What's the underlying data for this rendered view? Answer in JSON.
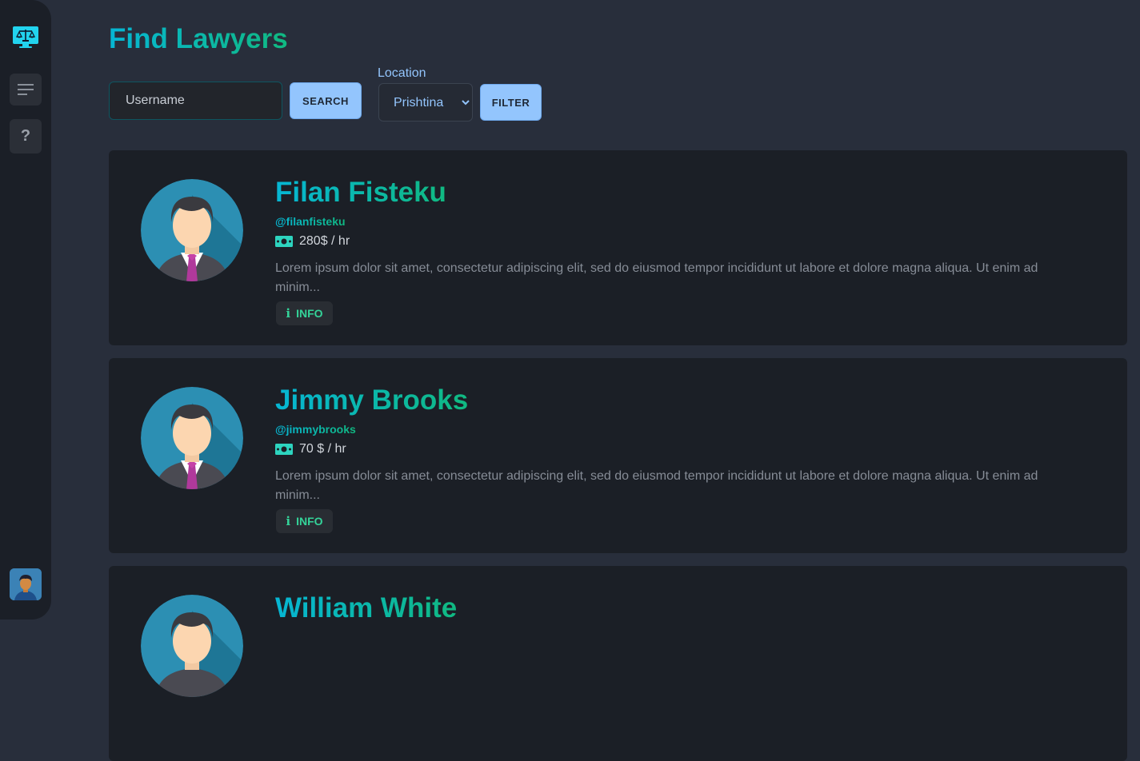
{
  "sidebar": {
    "logo_icon": "lawyer-scale-monitor-icon",
    "menu_icon": "menu-lines-icon",
    "help_label": "?",
    "avatar_icon": "user-avatar-icon"
  },
  "page": {
    "title": "Find Lawyers"
  },
  "search": {
    "placeholder": "Username",
    "button_label": "SEARCH"
  },
  "filter": {
    "location_label": "Location",
    "location_selected": "Prishtina",
    "button_label": "FILTER"
  },
  "lawyers": [
    {
      "name": "Filan Fisteku",
      "username": "@filanfisteku",
      "rate": "280$ / hr",
      "description": "Lorem ipsum dolor sit amet, consectetur adipiscing elit, sed do eiusmod tempor incididunt ut labore et dolore magna aliqua. Ut enim ad minim...",
      "info_label": "INFO"
    },
    {
      "name": "Jimmy Brooks",
      "username": "@jimmybrooks",
      "rate": "70 $ / hr",
      "description": "Lorem ipsum dolor sit amet, consectetur adipiscing elit, sed do eiusmod tempor incididunt ut labore et dolore magna aliqua. Ut enim ad minim...",
      "info_label": "INFO"
    },
    {
      "name": "William White"
    }
  ],
  "colors": {
    "gradient_start": "#06b6d4",
    "gradient_end": "#10b981",
    "primary_button": "#93c5fd",
    "background": "#282e3b",
    "card": "#1b1f26"
  }
}
